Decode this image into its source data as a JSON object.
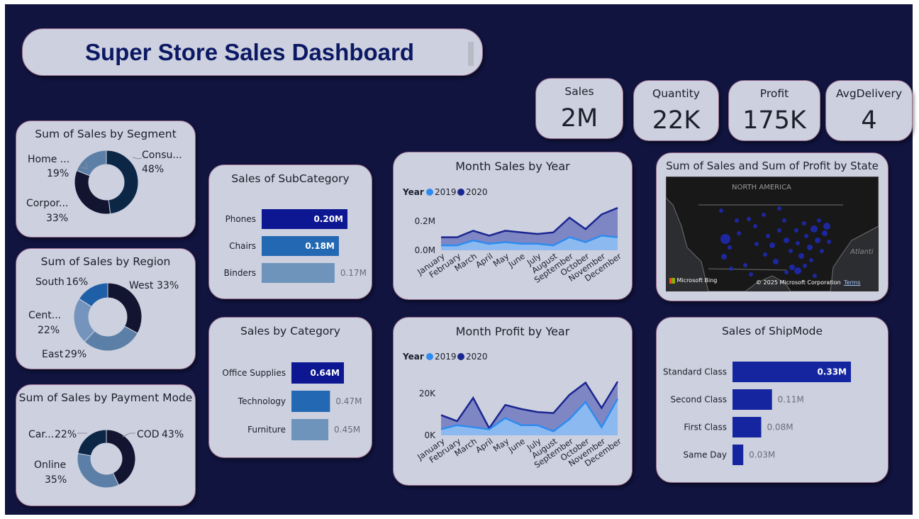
{
  "header": {
    "title": "Super Store Sales Dashboard"
  },
  "colors": {
    "background": "#10143f",
    "card": "#cdd0de",
    "card_border": "#9c6f93",
    "title": "#0b1863",
    "series_2019": "#2d8cf0",
    "series_2020": "#1a2690",
    "bar_dark": "#0c1791",
    "bar_mid": "#2368b2",
    "bar_light": "#6e94bb",
    "donut": [
      "#0c2746",
      "#111530",
      "#5b7fa6",
      "#1f5fa8",
      "#7594bd"
    ]
  },
  "kpis": [
    {
      "label": "Sales",
      "value": "2M"
    },
    {
      "label": "Quantity",
      "value": "22K"
    },
    {
      "label": "Profit",
      "value": "175K"
    },
    {
      "label": "AvgDelivery",
      "value": "4"
    }
  ],
  "map": {
    "title": "Sum of Sales and Sum of Profit by State",
    "region_label": "NORTH AMERICA",
    "ocean_label": "Atlanti",
    "brand": "Microsoft Bing",
    "copyright": "© 2025 Microsoft Corporation",
    "terms": "Terms"
  },
  "chart_data": [
    {
      "type": "pie",
      "title": "Sum of Sales by Segment",
      "slices": [
        {
          "label": "Consu...",
          "pct": "48%",
          "value": 48
        },
        {
          "label": "Corpor...",
          "pct": "33%",
          "value": 33
        },
        {
          "label": "Home ...",
          "pct": "19%",
          "value": 19
        }
      ]
    },
    {
      "type": "pie",
      "title": "Sum of Sales by Region",
      "slices": [
        {
          "label": "West",
          "pct": "33%",
          "value": 33
        },
        {
          "label": "East",
          "pct": "29%",
          "value": 29
        },
        {
          "label": "Cent...",
          "pct": "22%",
          "value": 22
        },
        {
          "label": "South",
          "pct": "16%",
          "value": 16
        }
      ]
    },
    {
      "type": "pie",
      "title": "Sum of Sales by Payment Mode",
      "slices": [
        {
          "label": "COD",
          "pct": "43%",
          "value": 43
        },
        {
          "label": "Online",
          "pct": "35%",
          "value": 35
        },
        {
          "label": "Car...",
          "pct": "22%",
          "value": 22
        }
      ]
    },
    {
      "type": "bar",
      "title": "Sales of SubCategory",
      "categories": [
        "Phones",
        "Chairs",
        "Binders"
      ],
      "values": [
        0.2,
        0.18,
        0.17
      ],
      "labels": [
        "0.20M",
        "0.18M",
        "0.17M"
      ]
    },
    {
      "type": "bar",
      "title": "Sales by Category",
      "categories": [
        "Office Supplies",
        "Technology",
        "Furniture"
      ],
      "values": [
        0.64,
        0.47,
        0.45
      ],
      "labels": [
        "0.64M",
        "0.47M",
        "0.45M"
      ]
    },
    {
      "type": "area",
      "title": "Month Sales by Year",
      "legend_title": "Year",
      "categories": [
        "January",
        "February",
        "March",
        "April",
        "May",
        "June",
        "July",
        "August",
        "September",
        "October",
        "November",
        "December"
      ],
      "yticks": [
        "0.2M",
        "0.0M"
      ],
      "ylim": [
        0,
        0.3
      ],
      "series": [
        {
          "name": "2019",
          "values": [
            0.03,
            0.03,
            0.06,
            0.04,
            0.05,
            0.04,
            0.04,
            0.03,
            0.08,
            0.05,
            0.09,
            0.08
          ]
        },
        {
          "name": "2020",
          "values": [
            0.08,
            0.08,
            0.12,
            0.09,
            0.12,
            0.11,
            0.1,
            0.11,
            0.2,
            0.13,
            0.22,
            0.26
          ]
        }
      ]
    },
    {
      "type": "area",
      "title": "Month Profit by Year",
      "legend_title": "Year",
      "categories": [
        "January",
        "February",
        "March",
        "April",
        "May",
        "June",
        "July",
        "August",
        "September",
        "October",
        "November",
        "December"
      ],
      "yticks": [
        "20K",
        "0K"
      ],
      "ylim": [
        0,
        35000
      ],
      "series": [
        {
          "name": "2019",
          "values": [
            3000,
            5000,
            4000,
            3000,
            8500,
            5000,
            5000,
            2000,
            8000,
            16500,
            4000,
            18000
          ]
        },
        {
          "name": "2020",
          "values": [
            10000,
            7000,
            18500,
            3500,
            15000,
            13000,
            11500,
            11000,
            20000,
            26000,
            13500,
            26500
          ]
        }
      ]
    },
    {
      "type": "bar",
      "title": "Sales of ShipMode",
      "categories": [
        "Standard Class",
        "Second Class",
        "First Class",
        "Same Day"
      ],
      "values": [
        0.33,
        0.11,
        0.08,
        0.03
      ],
      "labels": [
        "0.33M",
        "0.11M",
        "0.08M",
        "0.03M"
      ]
    }
  ]
}
